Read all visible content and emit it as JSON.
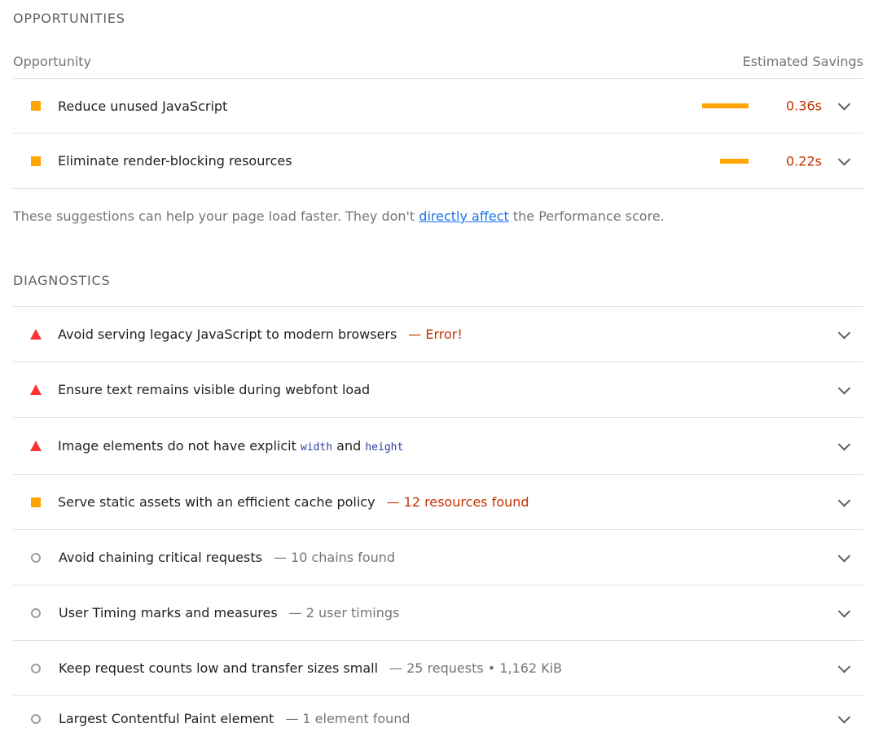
{
  "opportunities": {
    "section_title": "OPPORTUNITIES",
    "col_opportunity": "Opportunity",
    "col_savings": "Estimated Savings",
    "items": [
      {
        "title": "Reduce unused JavaScript",
        "savings": "0.36s",
        "rating": "average",
        "bar_fraction": 1.0
      },
      {
        "title": "Eliminate render-blocking resources",
        "savings": "0.22s",
        "rating": "average",
        "bar_fraction": 0.61
      }
    ],
    "note_before": "These suggestions can help your page load faster. They don't ",
    "note_link": "directly affect",
    "note_after": " the Performance score."
  },
  "diagnostics": {
    "section_title": "DIAGNOSTICS",
    "items": [
      {
        "title": "Avoid serving legacy JavaScript to modern browsers",
        "display": "— Error!",
        "rating": "fail"
      },
      {
        "title": "Ensure text remains visible during webfont load",
        "display": "",
        "rating": "fail"
      },
      {
        "title_pre": "Image elements do not have explicit ",
        "code1": "width",
        "title_mid": " and ",
        "code2": "height",
        "rating": "fail"
      },
      {
        "title": "Serve static assets with an efficient cache policy",
        "display": "— 12 resources found",
        "rating": "average"
      },
      {
        "title": "Avoid chaining critical requests",
        "display": "— 10 chains found",
        "rating": "informative"
      },
      {
        "title": "User Timing marks and measures",
        "display": "— 2 user timings",
        "rating": "informative"
      },
      {
        "title": "Keep request counts low and transfer sizes small",
        "display": "— 25 requests • 1,162 KiB",
        "rating": "informative"
      },
      {
        "title": "Largest Contentful Paint element",
        "display": "— 1 element found",
        "rating": "informative"
      }
    ]
  },
  "colors": {
    "average": "#ffa400",
    "fail": "#ff3333",
    "informative": "#9e9e9e",
    "savings_text": "#c33300",
    "link": "#1a73e8"
  },
  "icons": {
    "average": "orange-square-icon",
    "fail": "red-triangle-icon",
    "informative": "gray-circle-icon",
    "expand": "chevron-down-icon"
  }
}
